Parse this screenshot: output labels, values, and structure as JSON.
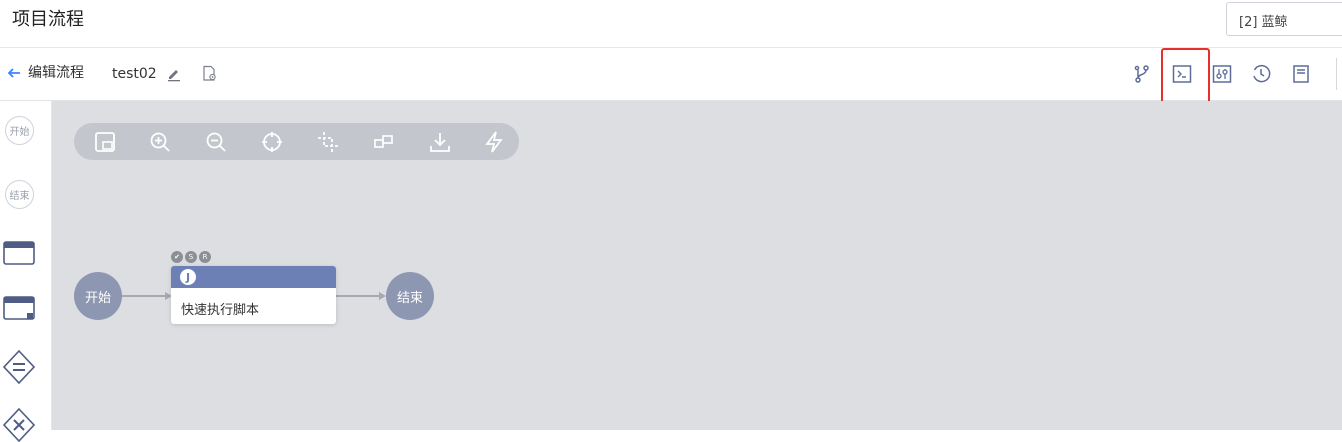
{
  "header": {
    "title": "项目流程",
    "project_select_value": "[2] 蓝鲸"
  },
  "toolbar": {
    "back_label": "编辑流程",
    "flow_name": "test02",
    "icons": [
      "branch-icon",
      "terminal-icon",
      "variable-settings-icon",
      "history-icon",
      "document-icon"
    ],
    "highlight_color": "#e8302b"
  },
  "palette": {
    "start_label": "开始",
    "end_label": "结束",
    "items": [
      "start-node",
      "end-node",
      "task-node",
      "subprocess-node",
      "parallel-gateway",
      "branch-gateway"
    ]
  },
  "canvas_toolbar": {
    "tools": [
      "fit-view-icon",
      "zoom-in-icon",
      "zoom-out-icon",
      "locate-icon",
      "select-area-icon",
      "arrange-icon",
      "download-icon",
      "quick-action-icon"
    ]
  },
  "flow": {
    "start_label": "开始",
    "end_label": "结束",
    "task": {
      "type_letter": "J",
      "label": "快速执行脚本",
      "status_marks": [
        "✔",
        "S",
        "R"
      ]
    }
  },
  "colors": {
    "canvas_bg": "#dcdee2",
    "node_circle": "#8e97b2",
    "task_header": "#6c80b5",
    "accent": "#3a84ff"
  }
}
